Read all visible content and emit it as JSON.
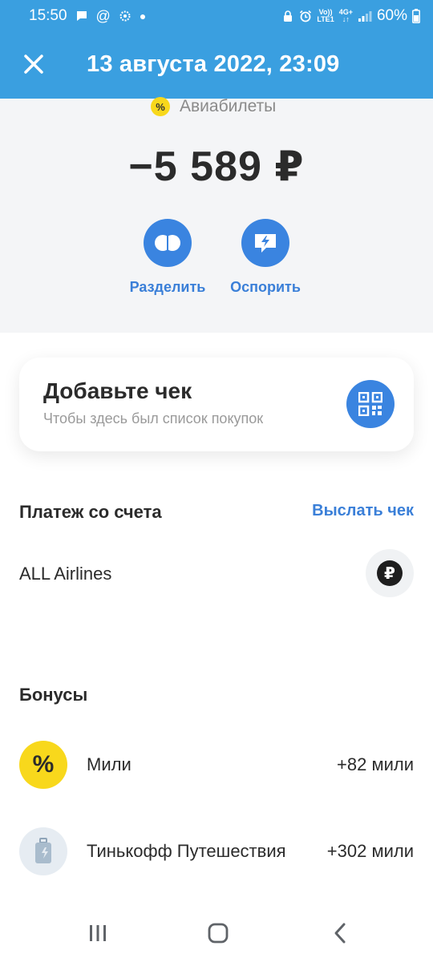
{
  "status_bar": {
    "time": "15:50",
    "volte_top": "Vo))",
    "volte_bottom": "LTE1",
    "network_type": "4G+",
    "battery": "60%"
  },
  "header": {
    "title": "13 августа 2022, 23:09"
  },
  "transaction": {
    "category_icon_glyph": "%",
    "category": "Авиабилеты",
    "amount": "−5 589 ₽",
    "actions": [
      {
        "label": "Разделить",
        "icon": "split-icon"
      },
      {
        "label": "Оспорить",
        "icon": "dispute-icon"
      }
    ]
  },
  "receipt_card": {
    "title": "Добавьте чек",
    "subtitle": "Чтобы здесь был список покупок",
    "icon": "qr-code-icon"
  },
  "payment": {
    "section_title": "Платеж со счета",
    "send_receipt_label": "Выслать чек",
    "merchant": "ALL Airlines",
    "merchant_icon_glyph": "₽"
  },
  "bonuses": {
    "section_title": "Бонусы",
    "items": [
      {
        "name": "Мили",
        "value": "+82 мили",
        "icon": "percent-icon",
        "icon_glyph": "%",
        "icon_bg": "#f8d81c"
      },
      {
        "name": "Тинькофф Путешествия",
        "value": "+302 мили",
        "icon": "suitcase-icon",
        "icon_bg": "#e6ecf2"
      }
    ]
  },
  "colors": {
    "accent_blue": "#3a9fe0",
    "button_blue": "#3a84e0",
    "link_blue": "#3a7fd8",
    "yellow": "#f8d81c"
  }
}
